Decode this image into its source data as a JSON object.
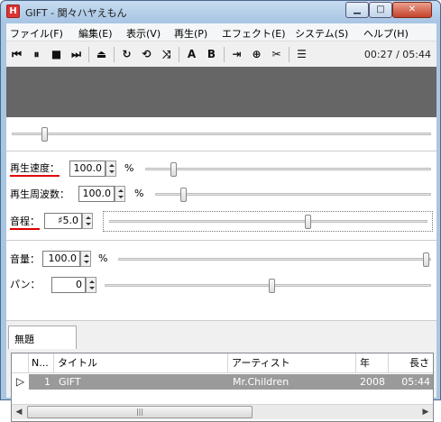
{
  "window": {
    "title": "GIFT - 関々ハヤえもん",
    "icon_letter": "H"
  },
  "menu": [
    "ファイル(F)",
    "編集(E)",
    "表示(V)",
    "再生(P)",
    "エフェクト(E)",
    "システム(S)",
    "ヘルプ(H)"
  ],
  "toolbar": {
    "buttons": [
      {
        "name": "prev-track-icon",
        "glyph": "⏮"
      },
      {
        "name": "pause-icon",
        "glyph": "⏸"
      },
      {
        "name": "stop-icon",
        "glyph": "■"
      },
      {
        "name": "next-track-icon",
        "glyph": "⏭"
      },
      {
        "name": "eject-icon",
        "glyph": "⏏"
      },
      {
        "name": "loop-one-icon",
        "glyph": "↻"
      },
      {
        "name": "loop-all-icon",
        "glyph": "⟲"
      },
      {
        "name": "random-icon",
        "glyph": "⤨"
      },
      {
        "name": "ab-a-icon",
        "glyph": "A"
      },
      {
        "name": "ab-b-icon",
        "glyph": "B"
      },
      {
        "name": "marker-play-icon",
        "glyph": "⇥"
      },
      {
        "name": "marker-add-icon",
        "glyph": "⊕"
      },
      {
        "name": "marker-delete-icon",
        "glyph": "✂"
      },
      {
        "name": "playlist-icon",
        "glyph": "☰"
      }
    ],
    "time": "00:27 / 05:44"
  },
  "controls": {
    "position": {
      "progress": 0.08
    },
    "speed": {
      "label": "再生速度：",
      "value": "100.0",
      "unit": "%"
    },
    "frequency": {
      "label": "再生周波数：",
      "value": "100.0",
      "unit": "%"
    },
    "pitch": {
      "label": "音程：",
      "value": "♯5.0"
    },
    "volume": {
      "label": "音量：",
      "value": "100.0",
      "unit": "%"
    },
    "pan": {
      "label": "パン：",
      "value": "0"
    }
  },
  "playlist": {
    "tab": "無題",
    "columns": [
      "N...",
      "タイトル",
      "アーティスト",
      "年",
      "長さ"
    ],
    "rows": [
      {
        "marker": "▷",
        "no": "1",
        "title": "GIFT",
        "artist": "Mr.Children",
        "year": "2008",
        "length": "05:44"
      }
    ]
  },
  "colors": {
    "video_area": "#666666",
    "selected_row": "#9a9a9a",
    "underline": "#dd0000"
  }
}
